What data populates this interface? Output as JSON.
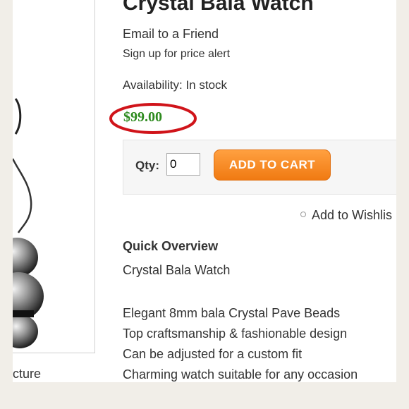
{
  "product": {
    "title": "Crystal Bala Watch",
    "email_friend": "Email to a Friend",
    "price_alert": "Sign up for price alert",
    "availability": "Availability: In stock",
    "price": "$99.00",
    "price_highlight_color": "#d0141a",
    "price_color": "#2e8b1f"
  },
  "cart": {
    "qty_label": "Qty:",
    "qty_value": "0",
    "add_button": "ADD TO CART",
    "button_color": "#f07a12"
  },
  "wishlist": {
    "label": "Add to Wishlis"
  },
  "overview": {
    "heading": "Quick Overview",
    "name": "Crystal Bala Watch",
    "features": [
      "Elegant 8mm bala Crystal Pave Beads",
      "Top craftsmanship & fashionable design",
      "Can be adjusted for a custom fit",
      "Charming watch suitable for any occasion"
    ]
  },
  "image": {
    "caption": "cture"
  }
}
